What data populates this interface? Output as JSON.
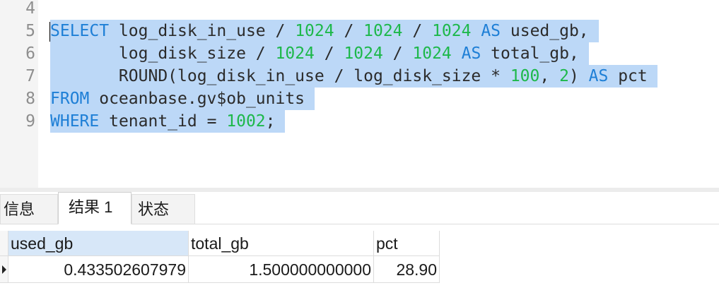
{
  "editor": {
    "lines": [
      {
        "n": "4",
        "tokens": []
      },
      {
        "n": "5",
        "tokens": [
          {
            "t": "SELECT",
            "c": "kw"
          },
          {
            "t": " log_disk_in_use / ",
            "c": ""
          },
          {
            "t": "1024",
            "c": "num"
          },
          {
            "t": " / ",
            "c": ""
          },
          {
            "t": "1024",
            "c": "num"
          },
          {
            "t": " / ",
            "c": ""
          },
          {
            "t": "1024",
            "c": "num"
          },
          {
            "t": " ",
            "c": ""
          },
          {
            "t": "AS",
            "c": "kw"
          },
          {
            "t": " used_gb, ",
            "c": ""
          }
        ]
      },
      {
        "n": "6",
        "tokens": [
          {
            "t": "       log_disk_size / ",
            "c": ""
          },
          {
            "t": "1024",
            "c": "num"
          },
          {
            "t": " / ",
            "c": ""
          },
          {
            "t": "1024",
            "c": "num"
          },
          {
            "t": " / ",
            "c": ""
          },
          {
            "t": "1024",
            "c": "num"
          },
          {
            "t": " ",
            "c": ""
          },
          {
            "t": "AS",
            "c": "kw"
          },
          {
            "t": " total_gb, ",
            "c": ""
          }
        ]
      },
      {
        "n": "7",
        "tokens": [
          {
            "t": "       ROUND(log_disk_in_use / log_disk_size * ",
            "c": ""
          },
          {
            "t": "100",
            "c": "num"
          },
          {
            "t": ", ",
            "c": ""
          },
          {
            "t": "2",
            "c": "num"
          },
          {
            "t": ") ",
            "c": ""
          },
          {
            "t": "AS",
            "c": "kw"
          },
          {
            "t": " pct ",
            "c": ""
          }
        ]
      },
      {
        "n": "8",
        "tokens": [
          {
            "t": "FROM",
            "c": "kw"
          },
          {
            "t": " oceanbase.gv$ob_units ",
            "c": ""
          }
        ]
      },
      {
        "n": "9",
        "tokens": [
          {
            "t": "WHERE",
            "c": "kw"
          },
          {
            "t": " tenant_id = ",
            "c": ""
          },
          {
            "t": "1002",
            "c": "num"
          },
          {
            "t": "; ",
            "c": ""
          }
        ]
      }
    ]
  },
  "tabs": [
    {
      "label": "信息",
      "active": false
    },
    {
      "label": "结果 1",
      "active": true
    },
    {
      "label": "状态",
      "active": false
    }
  ],
  "result": {
    "columns": [
      "used_gb",
      "total_gb",
      "pct"
    ],
    "rows": [
      [
        "0.433502607979",
        "1.500000000000",
        "28.90"
      ]
    ]
  }
}
